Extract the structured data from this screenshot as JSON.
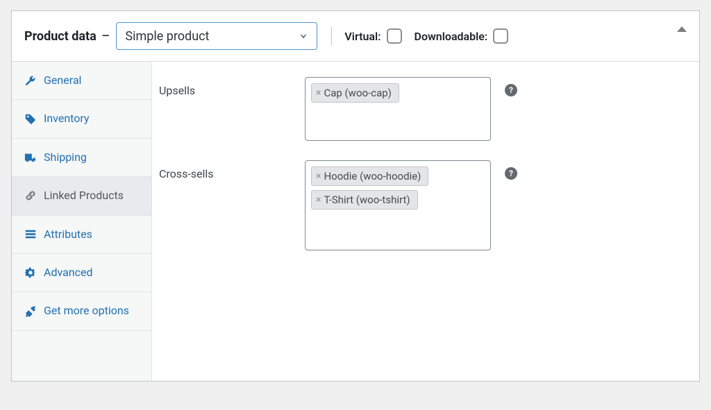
{
  "header": {
    "title": "Product data",
    "dash": "—",
    "productType": "Simple product",
    "virtual": "Virtual:",
    "downloadable": "Downloadable:"
  },
  "tabs": {
    "general": "General",
    "inventory": "Inventory",
    "shipping": "Shipping",
    "linked": "Linked Products",
    "attributes": "Attributes",
    "advanced": "Advanced",
    "more": "Get more options"
  },
  "linked": {
    "upsellsLabel": "Upsells",
    "crossLabel": "Cross-sells",
    "upsells": [
      {
        "label": "Cap (woo-cap)"
      }
    ],
    "cross": [
      {
        "label": "Hoodie (woo-hoodie)"
      },
      {
        "label": "T-Shirt (woo-tshirt)"
      }
    ]
  },
  "glyphs": {
    "x": "×",
    "q": "?"
  }
}
